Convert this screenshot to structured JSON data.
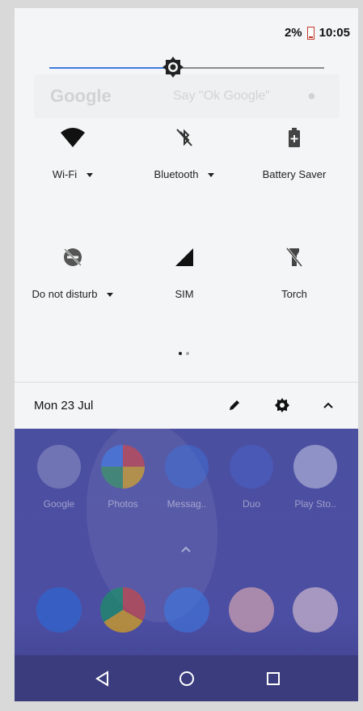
{
  "status_bar": {
    "battery_percent": "2%",
    "time": "10:05"
  },
  "brightness": {
    "level": 0.45
  },
  "google_bar": {
    "logo": "Google",
    "placeholder": "Say \"Ok Google\""
  },
  "quick_settings": [
    {
      "label": "Wi-Fi",
      "icon": "wifi-icon",
      "has_dropdown": true
    },
    {
      "label": "Bluetooth",
      "icon": "bluetooth-off-icon",
      "has_dropdown": true
    },
    {
      "label": "Battery Saver",
      "icon": "battery-saver-icon",
      "has_dropdown": false
    },
    {
      "label": "Do not disturb",
      "icon": "do-not-disturb-icon",
      "has_dropdown": true
    },
    {
      "label": "SIM",
      "icon": "signal-icon",
      "has_dropdown": false
    },
    {
      "label": "Torch",
      "icon": "flashlight-off-icon",
      "has_dropdown": false
    }
  ],
  "page_indicator": {
    "pages": 2,
    "current": 1
  },
  "footer": {
    "date": "Mon 23 Jul"
  },
  "apps": [
    {
      "name": "Google"
    },
    {
      "name": "Photos"
    },
    {
      "name": "Messag.."
    },
    {
      "name": "Duo"
    },
    {
      "name": "Play Sto.."
    }
  ],
  "dock": [
    "phone-icon",
    "chrome-icon",
    "settings-icon",
    "camera-icon",
    "gmail-icon"
  ],
  "nav": [
    "back-icon",
    "home-icon",
    "recents-icon"
  ]
}
